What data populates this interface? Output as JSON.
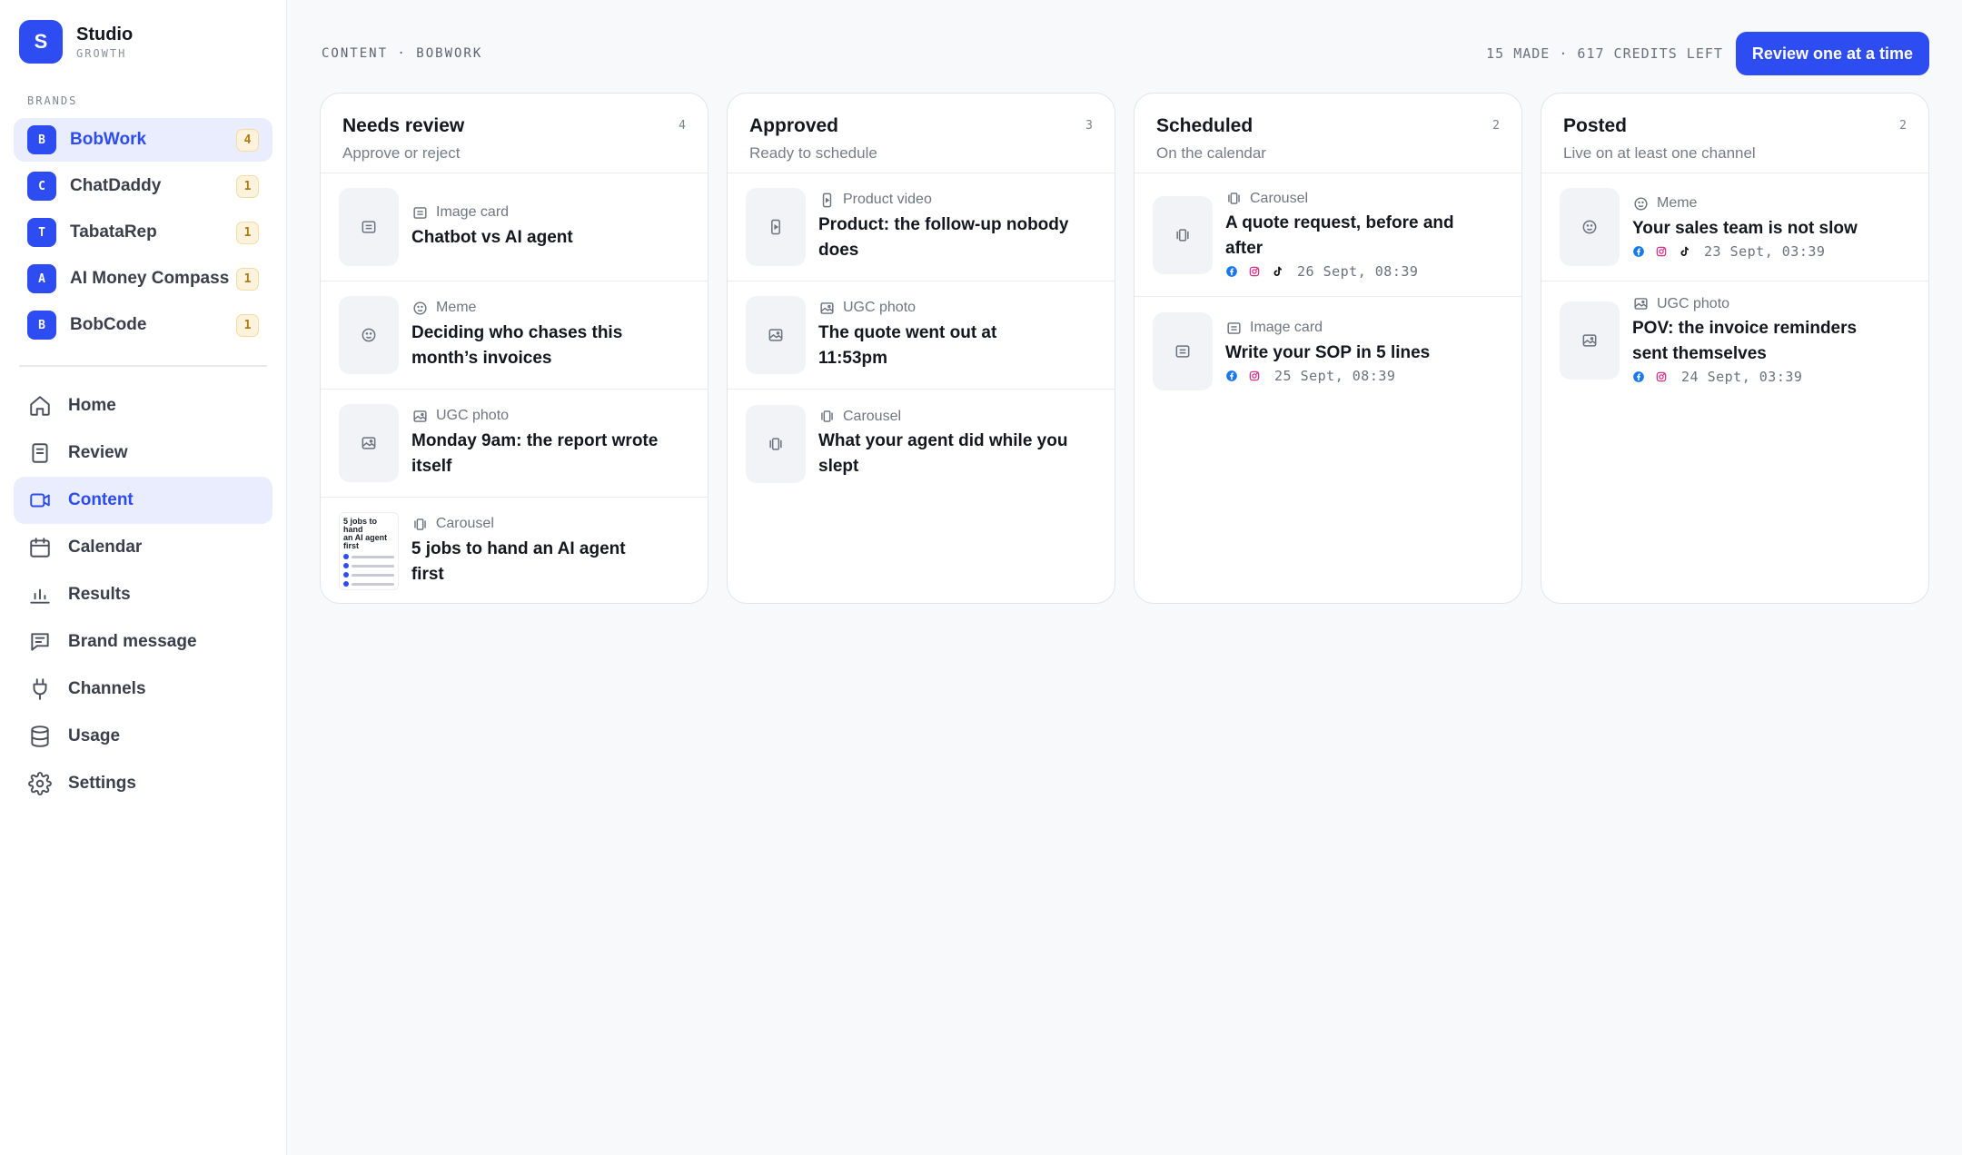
{
  "app": {
    "name": "Studio",
    "plan": "GROWTH",
    "logo_letter": "S"
  },
  "sidebar": {
    "brands_label": "BRANDS",
    "brands": [
      {
        "letter": "B",
        "name": "BobWork",
        "count": "4"
      },
      {
        "letter": "C",
        "name": "ChatDaddy",
        "count": "1"
      },
      {
        "letter": "T",
        "name": "TabataRep",
        "count": "1"
      },
      {
        "letter": "A",
        "name": "AI Money Compass",
        "count": "1"
      },
      {
        "letter": "B",
        "name": "BobCode",
        "count": "1"
      }
    ],
    "nav": [
      {
        "label": "Home",
        "icon": "home-icon"
      },
      {
        "label": "Review",
        "icon": "document-icon"
      },
      {
        "label": "Content",
        "icon": "video-icon"
      },
      {
        "label": "Calendar",
        "icon": "calendar-icon"
      },
      {
        "label": "Results",
        "icon": "bar-chart-icon"
      },
      {
        "label": "Brand message",
        "icon": "message-icon"
      },
      {
        "label": "Channels",
        "icon": "plug-icon"
      },
      {
        "label": "Usage",
        "icon": "database-icon"
      },
      {
        "label": "Settings",
        "icon": "gear-icon"
      }
    ]
  },
  "header": {
    "breadcrumb": "CONTENT · BOBWORK",
    "credits": "15 MADE · 617 CREDITS LEFT",
    "review_button": "Review one at a time"
  },
  "columns": [
    {
      "title": "Needs review",
      "subtitle": "Approve or reject",
      "count": "4",
      "cards": [
        {
          "type": "Image card",
          "title": "Chatbot vs AI agent"
        },
        {
          "type": "Meme",
          "title": "Deciding who chases this month’s invoices"
        },
        {
          "type": "UGC photo",
          "title": "Monday 9am: the report wrote itself"
        },
        {
          "type": "Carousel",
          "title": "5 jobs to hand an AI agent first",
          "preview_title_a": "5 jobs to hand",
          "preview_title_b": "an AI agent first"
        }
      ]
    },
    {
      "title": "Approved",
      "subtitle": "Ready to schedule",
      "count": "3",
      "cards": [
        {
          "type": "Product video",
          "title": "Product: the follow-up nobody does"
        },
        {
          "type": "UGC photo",
          "title": "The quote went out at 11:53pm"
        },
        {
          "type": "Carousel",
          "title": "What your agent did while you slept"
        }
      ]
    },
    {
      "title": "Scheduled",
      "subtitle": "On the calendar",
      "count": "2",
      "cards": [
        {
          "type": "Carousel",
          "title": "A quote request, before and after",
          "date": "26 Sept, 08:39"
        },
        {
          "type": "Image card",
          "title": "Write your SOP in 5 lines",
          "date": "25 Sept, 08:39"
        }
      ]
    },
    {
      "title": "Posted",
      "subtitle": "Live on at least one channel",
      "count": "2",
      "cards": [
        {
          "type": "Meme",
          "title": "Your sales team is not slow",
          "date": "23 Sept, 03:39"
        },
        {
          "type": "UGC photo",
          "title": "POV: the invoice reminders sent themselves",
          "date": "24 Sept, 03:39"
        }
      ]
    }
  ],
  "colors": {
    "accent": "#2d4cf2",
    "badge_bg": "#fdf2dc",
    "badge_text": "#b07a13",
    "facebook": "#1877f2",
    "instagram": "#d6338a",
    "tiktok": "#111111"
  }
}
